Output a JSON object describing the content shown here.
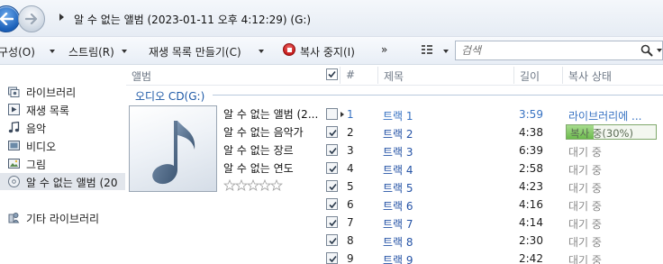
{
  "address": {
    "breadcrumb": "알 수 없는 앨범 (2023-01-11 오후 4:12:29) (G:)"
  },
  "toolbar": {
    "organize": "구성(O)",
    "stream": "스트림(R)",
    "create_playlist": "재생 목록 만들기(C)",
    "stop_rip": "복사 중지(I)",
    "overflow": "»",
    "search_placeholder": "검색"
  },
  "navpane": {
    "items": [
      {
        "label": "라이브러리",
        "icon": "library-icon"
      },
      {
        "label": "재생 목록",
        "icon": "playlist-icon"
      },
      {
        "label": "음악",
        "icon": "music-icon"
      },
      {
        "label": "비디오",
        "icon": "video-icon"
      },
      {
        "label": "그림",
        "icon": "picture-icon"
      },
      {
        "label": "알 수 없는 앨범 (20",
        "icon": "cd-icon"
      },
      {
        "label": "기타 라이브러리",
        "icon": "other-library-icon"
      }
    ]
  },
  "columns": {
    "album": "앨범",
    "number": "#",
    "title": "제목",
    "length": "길이",
    "rip_status": "복사 상태"
  },
  "group": {
    "header": "오디오 CD(G:)",
    "album_title": "알 수 없는 앨범 (2...",
    "artist": "알 수 없는 음악가",
    "genre": "알 수 없는 장르",
    "year": "알 수 없는 연도",
    "rating_stars": 0
  },
  "tracks": [
    {
      "num": "1",
      "title": "트랙 1",
      "length": "3:59",
      "status": "라이브러리에 ...",
      "checked": false,
      "playing": true
    },
    {
      "num": "2",
      "title": "트랙 2",
      "length": "4:38",
      "status": "복사 중(30%)",
      "progress": 0.3,
      "checked": true
    },
    {
      "num": "3",
      "title": "트랙 3",
      "length": "6:39",
      "status": "대기 중",
      "checked": true
    },
    {
      "num": "4",
      "title": "트랙 4",
      "length": "2:58",
      "status": "대기 중",
      "checked": true
    },
    {
      "num": "5",
      "title": "트랙 5",
      "length": "4:23",
      "status": "대기 중",
      "checked": true
    },
    {
      "num": "6",
      "title": "트랙 6",
      "length": "4:16",
      "status": "대기 중",
      "checked": true
    },
    {
      "num": "7",
      "title": "트랙 7",
      "length": "4:14",
      "status": "대기 중",
      "checked": true
    },
    {
      "num": "8",
      "title": "트랙 8",
      "length": "2:30",
      "status": "대기 중",
      "checked": true
    },
    {
      "num": "9",
      "title": "트랙 9",
      "length": "2:42",
      "status": "대기 중",
      "checked": true
    }
  ],
  "colors": {
    "accent_blue": "#3772c2",
    "progress_green": "#6cbb4d",
    "stop_red": "#c41818"
  }
}
